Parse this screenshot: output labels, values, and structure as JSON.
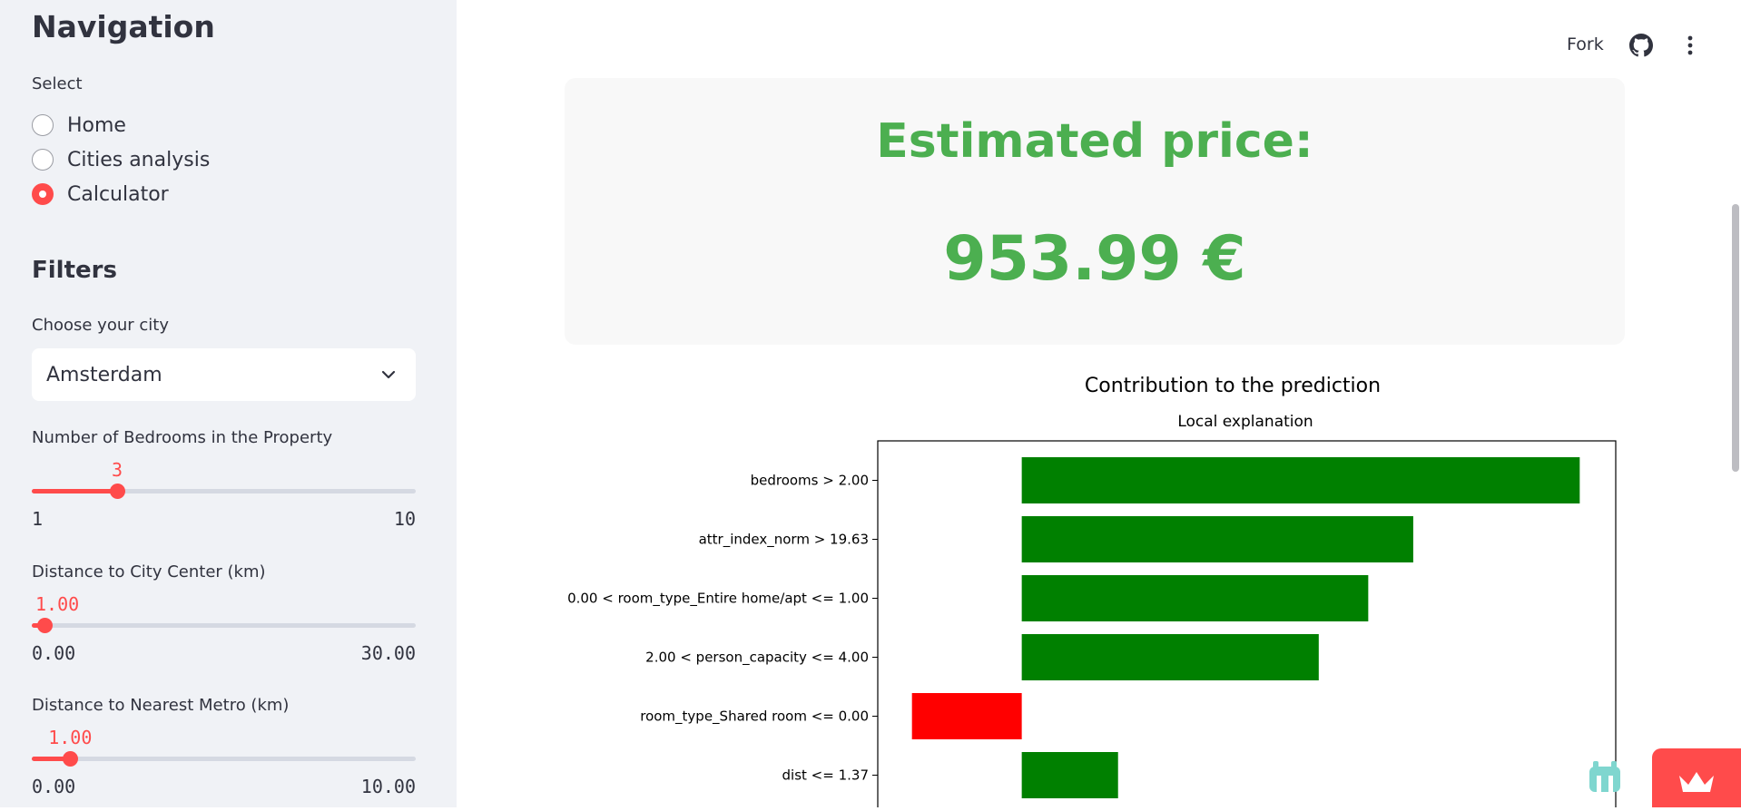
{
  "sidebar": {
    "title": "Navigation",
    "select_label": "Select",
    "options": [
      "Home",
      "Cities analysis",
      "Calculator"
    ],
    "selected_option": "Calculator",
    "filters_title": "Filters",
    "city": {
      "label": "Choose your city",
      "value": "Amsterdam"
    },
    "bedrooms": {
      "label": "Number of Bedrooms in the Property",
      "value": 3,
      "display": "3",
      "min": 1,
      "max": 10,
      "min_label": "1",
      "max_label": "10"
    },
    "center_distance": {
      "label": "Distance to City Center (km)",
      "value": 1.0,
      "display": "1.00",
      "min": 0,
      "max": 30,
      "min_label": "0.00",
      "max_label": "30.00"
    },
    "metro_distance": {
      "label": "Distance to Nearest Metro (km)",
      "value": 1.0,
      "display": "1.00",
      "min": 0,
      "max": 10,
      "min_label": "0.00",
      "max_label": "10.00"
    }
  },
  "toolbar": {
    "fork_label": "Fork"
  },
  "result": {
    "heading": "Estimated price:",
    "price": "953.99 €"
  },
  "colors": {
    "accent": "#ff4b4b",
    "price_green": "#4caf50",
    "bar_positive": "#008000",
    "bar_negative": "#ff0000"
  },
  "icons": {
    "github": "github-icon",
    "menu": "kebab-menu-icon",
    "dropdown": "chevron-down-icon",
    "streamlit": "streamlit-crown-icon",
    "mascot": "mascot-icon"
  },
  "chart_data": {
    "type": "bar",
    "orientation": "horizontal",
    "title": "Contribution to the prediction",
    "subtitle": "Local explanation",
    "categories": [
      "bedrooms > 2.00",
      "attr_index_norm > 19.63",
      "0.00 < room_type_Entire home/apt <= 1.00",
      "2.00 < person_capacity <= 4.00",
      "room_type_Shared room <= 0.00",
      "dist <= 1.37"
    ],
    "values": [
      0.62,
      0.435,
      0.385,
      0.33,
      -0.122,
      0.107
    ],
    "xlim": [
      -0.16,
      0.66
    ]
  }
}
